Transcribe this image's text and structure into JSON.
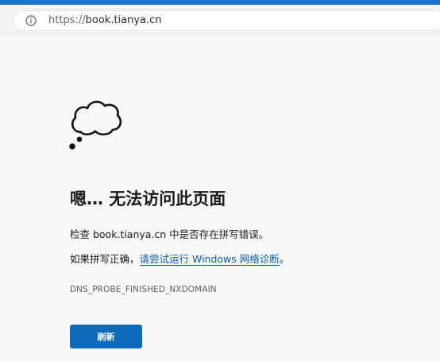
{
  "browser": {
    "address_bar": {
      "scheme": "https://",
      "host": "book.tianya.cn",
      "icon": "info-icon"
    },
    "accent_color": "#1a73c9"
  },
  "error_page": {
    "icon": "thought-cloud-icon",
    "title": "嗯… 无法访问此页面",
    "message_1": "检查 book.tianya.cn 中是否存在拼写错误。",
    "message_2_prefix": "如果拼写正确，",
    "message_2_link": "请尝试运行 Windows 网络诊断",
    "message_2_suffix": "。",
    "error_code": "DNS_PROBE_FINISHED_NXDOMAIN",
    "refresh_label": "刷新",
    "button_color": "#0f6cbd",
    "link_color": "#0b5cad"
  }
}
